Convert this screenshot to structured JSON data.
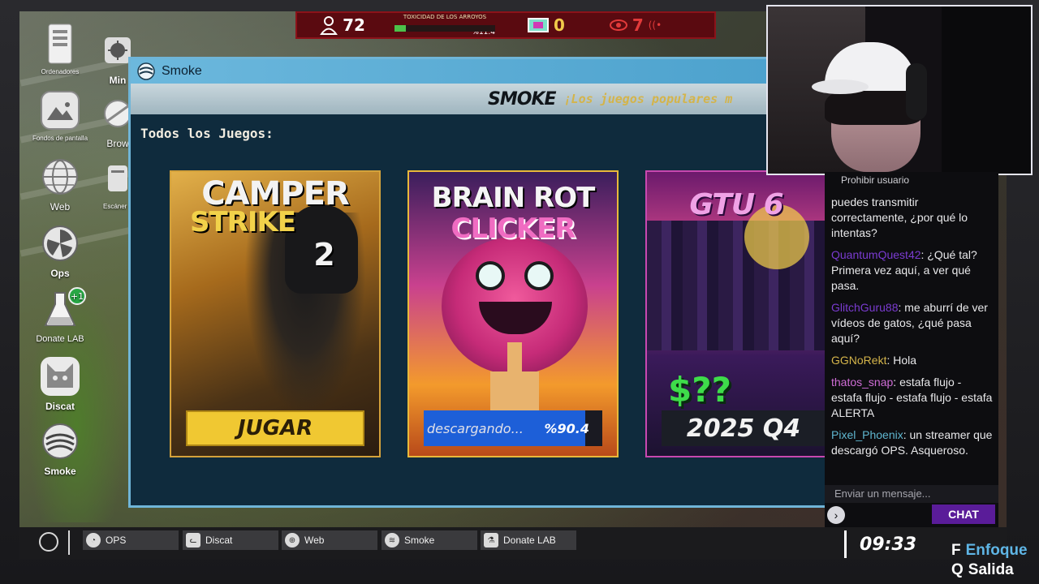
{
  "hud": {
    "players": "72",
    "toxicity_label": "TOXICIDAD DE LOS ARROYOS",
    "toxicity_pct": "%11.4",
    "toxicity_level": 0.114,
    "coins": "0",
    "alerts": "7",
    "colors": {
      "hud_bg": "#5a0a10",
      "toxicity": "#4cc14a",
      "coin": "#f0c94a",
      "alert": "#e23a3a"
    }
  },
  "desktop": {
    "icons": [
      {
        "label": "Ordenadores",
        "icon": "computer-icon"
      },
      {
        "label": "Min",
        "icon": "mine-icon"
      },
      {
        "label": "Fondos de pantalla",
        "icon": "wallpaper-icon"
      },
      {
        "label": "Brow",
        "icon": "browser-icon"
      },
      {
        "label": "Web",
        "icon": "globe-icon"
      },
      {
        "label": "Escáner d",
        "icon": "scanner-icon"
      },
      {
        "label": "Ops",
        "icon": "ops-icon"
      },
      {
        "label": "Donate LAB",
        "icon": "flask-icon",
        "badge": "+1"
      },
      {
        "label": "Discat",
        "icon": "cat-icon"
      },
      {
        "label": "Smoke",
        "icon": "smoke-icon"
      }
    ]
  },
  "window": {
    "title": "Smoke",
    "brand": "SMOKE",
    "tagline": "¡Los juegos populares m",
    "section_title": "Todos los Juegos:",
    "games": [
      {
        "title_line1": "CAMPER",
        "title_line2": "STRIKE",
        "title_line3": "2",
        "action": "JUGAR",
        "icon": "soldier-art"
      },
      {
        "title_line1": "BRAIN ROT",
        "title_line2": "CLICKER",
        "status": "descargando...",
        "progress": "%90.4",
        "progress_value": 0.904,
        "icon": "brain-art"
      },
      {
        "title_line1": "GTU 6",
        "price": "$??",
        "release": "2025 Q4",
        "icon": "city-art"
      }
    ]
  },
  "chat": {
    "ban_label": "Prohibir usuario",
    "messages": [
      {
        "user": "",
        "text": "puedes transmitir correctamente, ¿por qué lo intentas?",
        "color": "#e8e8ea"
      },
      {
        "user": "QuantumQuest42",
        "text": ": ¿Qué tal? Primera vez aquí, a ver qué pasa.",
        "color": "#7a3bd0"
      },
      {
        "user": "GlitchGuru88",
        "text": ": me aburrí de ver vídeos de gatos, ¿qué pasa aquí?",
        "color": "#7a3bd0"
      },
      {
        "user": "GGNoRekt",
        "text": ": Hola",
        "color": "#d4b44a"
      },
      {
        "user": "thatos_snap",
        "text": ": estafa flujo - estafa flujo - estafa flujo - estafa ALERTA",
        "color": "#cf6dd6"
      },
      {
        "user": "Pixel_Phoenix",
        "text": ": un streamer que descargó OPS. Asqueroso.",
        "color": "#5fb6cf"
      }
    ],
    "input_placeholder": "Enviar un mensaje...",
    "chat_button": "CHAT"
  },
  "taskbar": {
    "items": [
      {
        "label": "OPS",
        "icon": "ops-icon"
      },
      {
        "label": "Discat",
        "icon": "cat-icon"
      },
      {
        "label": "Web",
        "icon": "globe-icon"
      },
      {
        "label": "Smoke",
        "icon": "smoke-icon"
      },
      {
        "label": "Donate LAB",
        "icon": "flask-icon"
      }
    ],
    "clock": "09:33"
  },
  "hints": [
    {
      "key": "F",
      "label": "Enfoque"
    },
    {
      "key": "Q",
      "label": "Salida"
    }
  ]
}
